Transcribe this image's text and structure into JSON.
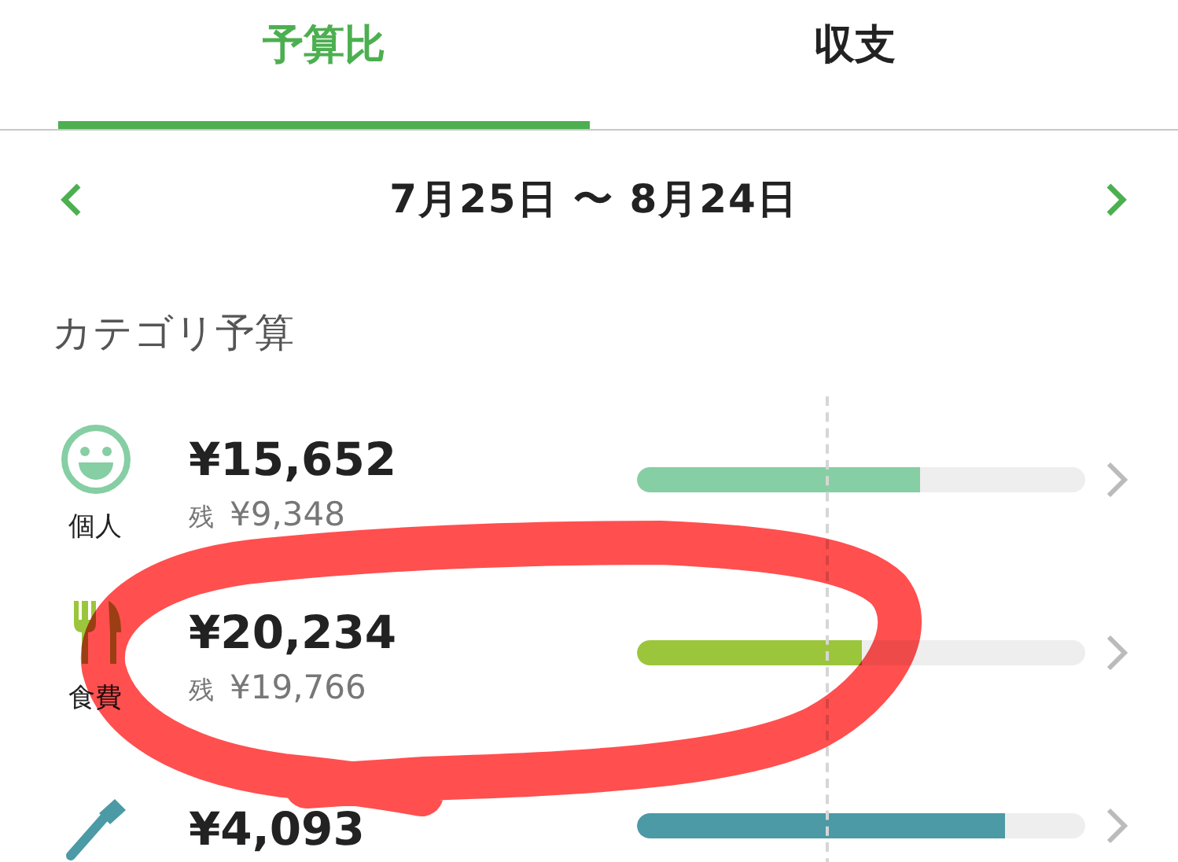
{
  "tabs": [
    {
      "label": "予算比",
      "selected": true
    },
    {
      "label": "収支",
      "selected": false
    }
  ],
  "period": {
    "label": "7月25日 〜 8月24日"
  },
  "section_title": "カテゴリ予算",
  "categories": [
    {
      "kind": "smile",
      "label": "個人",
      "amount": "¥15,652",
      "remaining_prefix": "残",
      "remaining": "¥9,348",
      "level": 0.63,
      "color": "#86cea3"
    },
    {
      "kind": "food",
      "label": "食費",
      "amount": "¥20,234",
      "remaining_prefix": "残",
      "remaining": "¥19,766",
      "level": 0.5,
      "color": "#9bc63c"
    },
    {
      "kind": "brush",
      "amount": "¥4,093",
      "level": 0.82,
      "color": "#4b9aa6"
    }
  ]
}
